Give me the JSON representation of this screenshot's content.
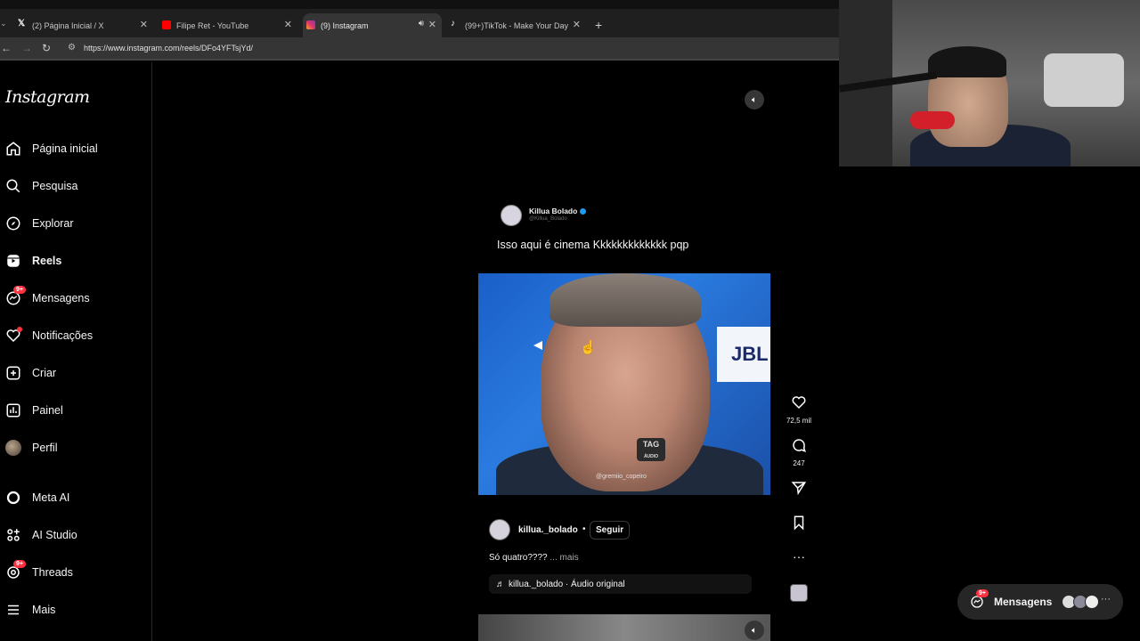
{
  "browser": {
    "tabs": [
      {
        "title": "(2) Página Inicial / X",
        "favicon": "x-logo-icon"
      },
      {
        "title": "Filipe Ret - YouTube",
        "favicon": "youtube-icon"
      },
      {
        "title": "(9) Instagram",
        "favicon": "instagram-icon",
        "active": true
      },
      {
        "title": "(99+)TikTok - Make Your Day",
        "favicon": "tiktok-icon"
      }
    ],
    "url": "https://www.instagram.com/reels/DFo4YFTsjYd/"
  },
  "sidebar": {
    "logo": "Instagram",
    "items": [
      {
        "label": "Página inicial",
        "icon": "home-icon"
      },
      {
        "label": "Pesquisa",
        "icon": "search-icon"
      },
      {
        "label": "Explorar",
        "icon": "compass-icon"
      },
      {
        "label": "Reels",
        "icon": "reels-icon",
        "active": true
      },
      {
        "label": "Mensagens",
        "icon": "messenger-icon",
        "badge": "9+"
      },
      {
        "label": "Notificações",
        "icon": "heart-icon",
        "dot": true
      },
      {
        "label": "Criar",
        "icon": "plus-square-icon"
      },
      {
        "label": "Painel",
        "icon": "chart-icon"
      },
      {
        "label": "Perfil",
        "icon": "avatar-icon"
      },
      {
        "label": "Meta AI",
        "icon": "meta-ai-icon"
      },
      {
        "label": "AI Studio",
        "icon": "ai-studio-icon"
      },
      {
        "label": "Threads",
        "icon": "threads-icon",
        "badge": "9+"
      },
      {
        "label": "Mais",
        "icon": "menu-icon"
      }
    ]
  },
  "reel": {
    "tweet": {
      "name": "Killua Bolado",
      "handle": "@Killua_Bolado",
      "text": "Isso aqui é cinema Kkkkkkkkkkkkk pqp"
    },
    "video": {
      "panel_text": "JBL",
      "mic_text": "TAG",
      "mic_sub": "ÁUDIO",
      "watermark": "@gremiio_copeiro"
    },
    "actions": {
      "likes": "72,5 mil",
      "comments": "247"
    },
    "author": "killua._bolado",
    "separator": "•",
    "follow_label": "Seguir",
    "caption": "Só quatro????",
    "caption_more": "... mais",
    "audio": "killua._bolado · Áudio original"
  },
  "messages_pill": {
    "label": "Mensagens",
    "badge": "9+"
  },
  "colors": {
    "accent_red": "#ff3040",
    "background": "#000000",
    "verified_blue": "#1d9bf0"
  }
}
